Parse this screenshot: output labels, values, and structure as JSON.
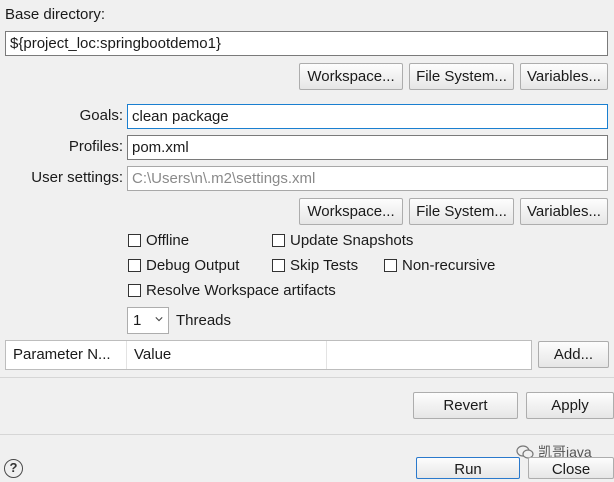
{
  "base_dir": {
    "label": "Base directory:",
    "value": "${project_loc:springbootdemo1}",
    "buttons": [
      "Workspace...",
      "File System...",
      "Variables..."
    ]
  },
  "goals": {
    "label": "Goals:",
    "value": "clean package"
  },
  "profiles": {
    "label": "Profiles:",
    "value": "pom.xml"
  },
  "user_settings": {
    "label": "User settings:",
    "value": "C:\\Users\\n\\.m2\\settings.xml",
    "buttons": [
      "Workspace...",
      "File System...",
      "Variables..."
    ]
  },
  "options": {
    "offline": "Offline",
    "update_snapshots": "Update Snapshots",
    "debug_output": "Debug Output",
    "skip_tests": "Skip Tests",
    "non_recursive": "Non-recursive",
    "resolve_workspace": "Resolve Workspace artifacts"
  },
  "threads": {
    "value": "1",
    "label": "Threads"
  },
  "parameters": {
    "columns": [
      "Parameter N...",
      "Value",
      ""
    ],
    "add_button": "Add..."
  },
  "actions": {
    "revert": "Revert",
    "apply": "Apply",
    "run": "Run",
    "close": "Close"
  },
  "help": {
    "glyph": "?"
  },
  "watermark": {
    "text": "凯哥java"
  }
}
